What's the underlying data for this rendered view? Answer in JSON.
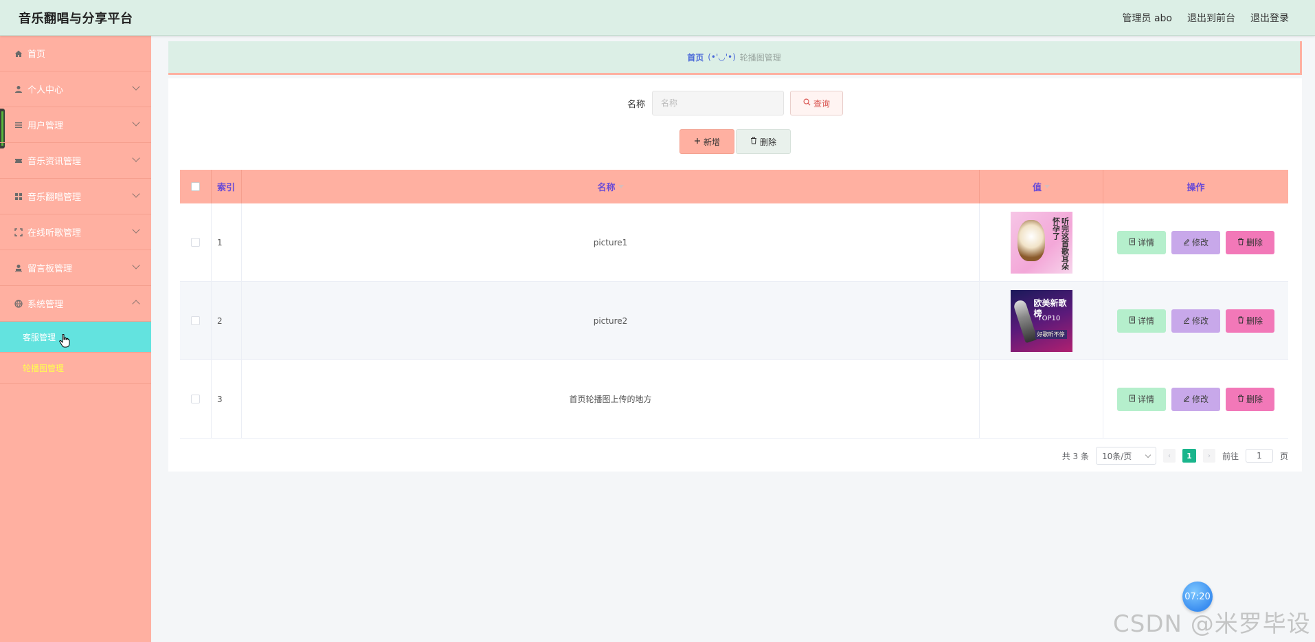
{
  "header": {
    "title": "音乐翻唱与分享平台",
    "admin_label": "管理员 abo",
    "to_frontend": "退出到前台",
    "logout": "退出登录"
  },
  "sidebar": {
    "items": [
      {
        "label": "首页",
        "icon": "home-icon"
      },
      {
        "label": "个人中心",
        "icon": "user-icon"
      },
      {
        "label": "用户管理",
        "icon": "list-icon"
      },
      {
        "label": "音乐资讯管理",
        "icon": "ticket-icon"
      },
      {
        "label": "音乐翻唱管理",
        "icon": "grid-icon"
      },
      {
        "label": "在线听歌管理",
        "icon": "fullscreen-icon"
      },
      {
        "label": "留言板管理",
        "icon": "user-stamp-icon"
      },
      {
        "label": "系统管理",
        "icon": "globe-icon"
      }
    ],
    "subitems": [
      {
        "label": "客服管理"
      },
      {
        "label": "轮播图管理"
      }
    ]
  },
  "breadcrumb": {
    "home": "首页",
    "separator": "(•'◡'•)",
    "current": "轮播图管理"
  },
  "search": {
    "label": "名称",
    "placeholder": "名称",
    "query_button": "查询"
  },
  "actions": {
    "add_button": "新增",
    "delete_button": "删除"
  },
  "table": {
    "columns": [
      "索引",
      "名称",
      "值",
      "操作"
    ],
    "rows": [
      {
        "index": "1",
        "name": "picture1"
      },
      {
        "index": "2",
        "name": "picture2"
      },
      {
        "index": "3",
        "name": "首页轮播图上传的地方"
      }
    ],
    "row_actions": {
      "detail": "详情",
      "edit": "修改",
      "remove": "删除"
    },
    "thumb_texts": {
      "t1": "听完这首歌耳朵怀孕了",
      "t2_title": "欧美新歌榜",
      "t2_sub": "TOP10",
      "t2_tag": "好歌听不停"
    }
  },
  "pagination": {
    "total": "共 3 条",
    "page_size": "10条/页",
    "current_page": "1",
    "goto_label": "前往",
    "goto_value": "1",
    "page_unit": "页"
  },
  "overlay": {
    "clock": "07:20",
    "watermark": "CSDN @米罗毕设"
  },
  "colors": {
    "sidebar": "#ffb0a1",
    "topbar": "#dcefe6",
    "active_sub": "#63e3df",
    "current_sub": "#ffff4d",
    "pager_active": "#1ab58c"
  }
}
